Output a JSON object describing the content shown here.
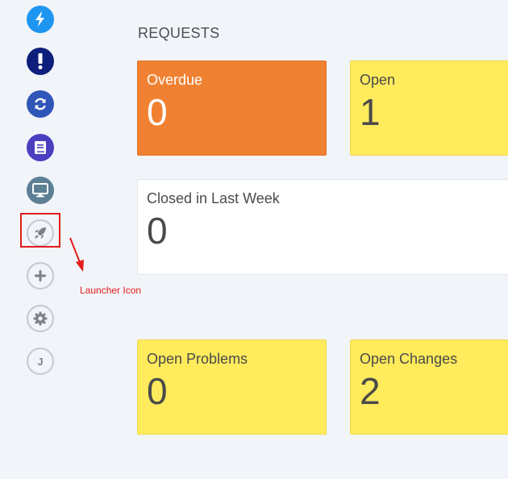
{
  "sidebar": {
    "items": [
      {
        "name": "lightning-icon",
        "color": "#1e96f0"
      },
      {
        "name": "exclamation-icon",
        "color": "#0d1f7a"
      },
      {
        "name": "refresh-icon",
        "color": "#2f56b8"
      },
      {
        "name": "book-icon",
        "color": "#4a3fbf"
      },
      {
        "name": "monitor-icon",
        "color": "#5c7f94"
      },
      {
        "name": "rocket-icon",
        "style": "outline"
      },
      {
        "name": "plus-icon",
        "style": "outline"
      },
      {
        "name": "gear-icon",
        "style": "outline"
      },
      {
        "name": "avatar",
        "letter": "J",
        "style": "outline"
      }
    ]
  },
  "annotation": {
    "label": "Launcher Icon",
    "color": "#e31c1c"
  },
  "main": {
    "title": "REQUESTS",
    "cards": {
      "overdue": {
        "label": "Overdue",
        "value": "0",
        "color": "#f08132"
      },
      "open": {
        "label": "Open",
        "value": "1",
        "color": "#ffeb5c"
      },
      "closed_last_week": {
        "label": "Closed in Last Week",
        "value": "0",
        "color": "#ffffff"
      },
      "open_problems": {
        "label": "Open Problems",
        "value": "0",
        "color": "#ffeb5c"
      },
      "open_changes": {
        "label": "Open Changes",
        "value": "2",
        "color": "#ffeb5c"
      }
    }
  }
}
